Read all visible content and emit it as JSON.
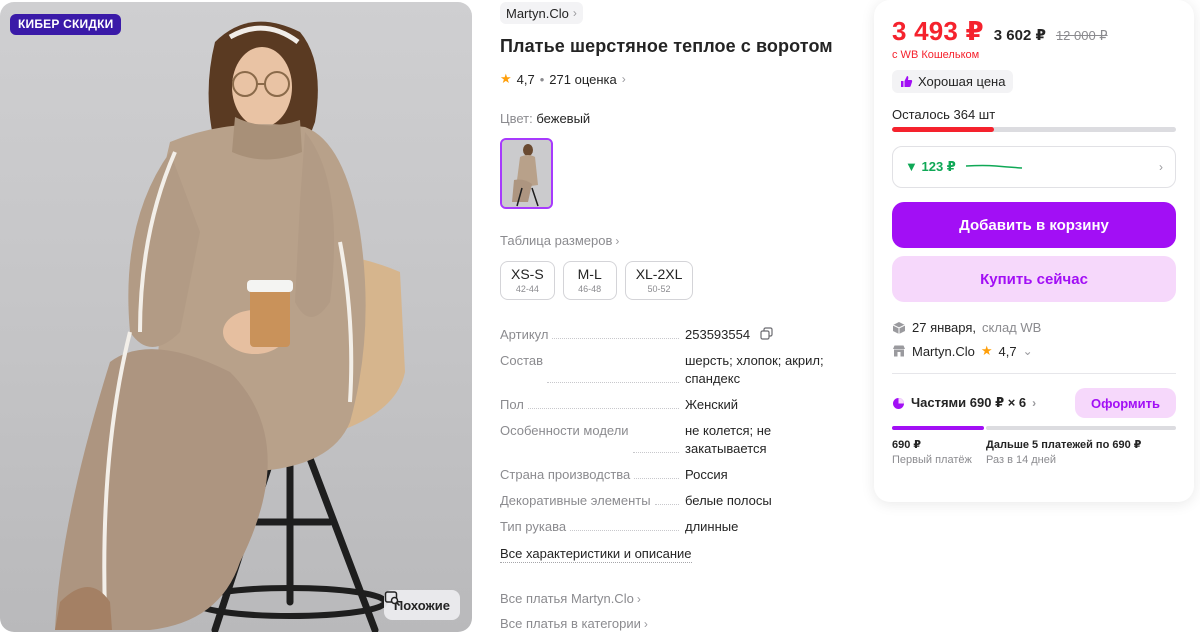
{
  "photo": {
    "badge": "КИБЕР СКИДКИ",
    "similar_label": "Похожие"
  },
  "product": {
    "brand": "Martyn.Clo",
    "title": "Платье шерстяное теплое с воротом",
    "rating": "4,7",
    "reviews": "271 оценка",
    "color_label": "Цвет:",
    "color_value": "бежевый",
    "size_table_label": "Таблица размеров",
    "sizes": [
      {
        "label": "XS-S",
        "range": "42-44"
      },
      {
        "label": "M-L",
        "range": "46-48"
      },
      {
        "label": "XL-2XL",
        "range": "50-52"
      }
    ],
    "specs": [
      {
        "key": "Артикул",
        "value": "253593554"
      },
      {
        "key": "Состав",
        "value": "шерсть; хлопок; акрил; спандекс"
      },
      {
        "key": "Пол",
        "value": "Женский"
      },
      {
        "key": "Особенности модели",
        "value": "не колется; не закатывается"
      },
      {
        "key": "Страна производства",
        "value": "Россия"
      },
      {
        "key": "Декоративные элементы",
        "value": "белые полосы"
      },
      {
        "key": "Тип рукава",
        "value": "длинные"
      }
    ],
    "all_specs_label": "Все характеристики и описание",
    "links": [
      "Все платья Martyn.Clo",
      "Все платья в категории"
    ]
  },
  "card": {
    "price_main": "3 493 ₽",
    "price_alt": "3 602 ₽",
    "price_old": "12 000 ₽",
    "wallet_note": "с WB Кошельком",
    "good_price": "Хорошая цена",
    "stock_text": "Осталось 364 шт",
    "stock_level": 0.36,
    "trend_value": "▼ 123 ₽",
    "add_to_cart": "Добавить в корзину",
    "buy_now": "Купить сейчас",
    "delivery_date": "27 января,",
    "warehouse": "склад WB",
    "seller": "Martyn.Clo",
    "seller_rating": "4,7",
    "installments_title": "Частями 690 ₽ × 6",
    "arrange_label": "Оформить",
    "first_payment_value": "690 ₽",
    "first_payment_label": "Первый платёж",
    "next_payments_value": "Дальше 5 платежей по 690 ₽",
    "next_payments_label": "Раз в 14 дней"
  },
  "colors": {
    "accent": "#a20ff5",
    "price_red": "#f5222d",
    "badge_bg": "#3a1aa8",
    "trend_green": "#0fa856"
  }
}
